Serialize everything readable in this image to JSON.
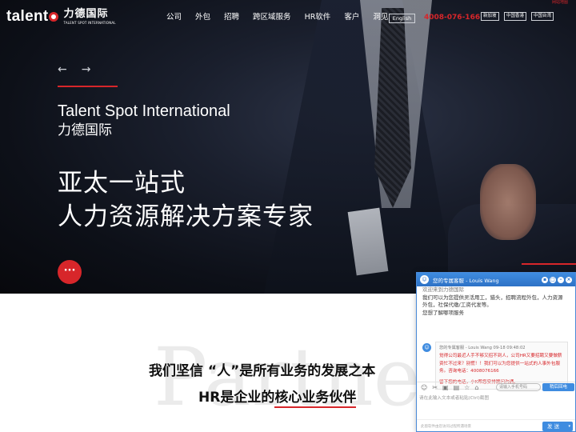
{
  "header": {
    "logo_word": "talent",
    "logo_cn": "力德国际",
    "logo_en": "TALENT SPOT INTERNATIONAL",
    "nav": [
      "公司",
      "外包",
      "招聘",
      "跨区域服务",
      "HR软件",
      "客户",
      "洞见"
    ],
    "lang_button": "English",
    "phone": "4008-076-166",
    "regions": [
      "新加坡",
      "中国香港",
      "中国台湾"
    ],
    "top_link": "网站地图"
  },
  "hero": {
    "prev_arrow": "←",
    "next_arrow": "→",
    "title_en": "Talent Spot International",
    "title_cn": "力德国际",
    "slogan_line1": "亚太一站式",
    "slogan_line2": "人力资源解决方案专家",
    "more_button": "···"
  },
  "belief": {
    "watermark": "Partner",
    "line1": "我们坚信 “人”是所有业务的发展之本",
    "line2_prefix": "HR是企业的",
    "line2_underlined": "核心业务伙伴"
  },
  "chat": {
    "title": "您的专属客服 - Louis Wang",
    "first_message_cut": "欢迎来到力德国际",
    "first_message": "我们可以为您提供灵活用工，猎头，招聘流程外包，人力资源外包，社保代缴/工资代发等。",
    "first_message_end": "您想了解哪项服务",
    "agent_meta": "您的专属客服 - Louis Wang    09-18 09:48:02",
    "agent_message": "觉得公司最近人手不够又招不到人，公司HR又要招聘又要做薪资忙不过来？别慌！！我们可以为您提供一站式的人事外包服务。咨询电话：4008076166",
    "agent_message_2": "留下您的电话，小K帮您安排顾问沟通。",
    "phone_placeholder": "请输入手机号码",
    "callback_button": "稍后回电",
    "input_placeholder": "请在此输入文本或者粘贴(Ctrl)截图",
    "footer_note": "此窗软件由您访问过程所遇场景",
    "send_button": "发 送",
    "send_dropdown": "▾",
    "colors": {
      "accent": "#3f8ce0",
      "alert": "#d7262a"
    }
  }
}
